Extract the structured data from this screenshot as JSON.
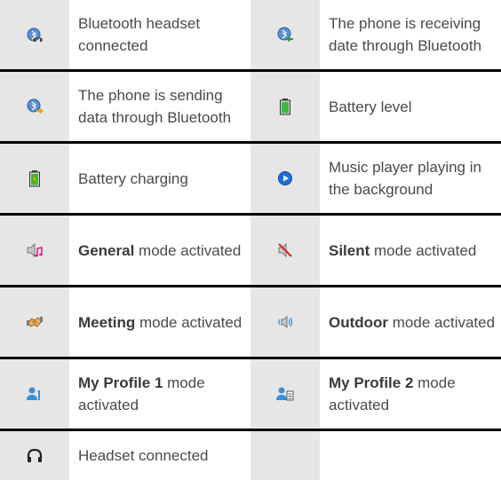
{
  "rows": [
    {
      "left": {
        "icon": "bluetooth-headset-icon",
        "bold": "",
        "text": "Bluetooth headset connected"
      },
      "right": {
        "icon": "bluetooth-receive-icon",
        "bold": "",
        "text": "The phone is receiving date through Bluetooth"
      }
    },
    {
      "left": {
        "icon": "bluetooth-send-icon",
        "bold": "",
        "text": "The phone is sending data through Bluetooth"
      },
      "right": {
        "icon": "battery-level-icon",
        "bold": "",
        "text": "Battery level"
      }
    },
    {
      "left": {
        "icon": "battery-charging-icon",
        "bold": "",
        "text": "Battery charging"
      },
      "right": {
        "icon": "music-player-icon",
        "bold": "",
        "text": "Music player playing in the background"
      }
    },
    {
      "left": {
        "icon": "general-mode-icon",
        "bold": "General",
        "text": " mode activated"
      },
      "right": {
        "icon": "silent-mode-icon",
        "bold": "Silent",
        "text": " mode activated"
      }
    },
    {
      "left": {
        "icon": "meeting-mode-icon",
        "bold": "Meeting",
        "text": " mode activated"
      },
      "right": {
        "icon": "outdoor-mode-icon",
        "bold": "Outdoor",
        "text": " mode activated"
      }
    },
    {
      "left": {
        "icon": "my-profile-1-icon",
        "bold": "My Profile 1",
        "text": " mode activated"
      },
      "right": {
        "icon": "my-profile-2-icon",
        "bold": "My Profile 2",
        "text": " mode activated"
      }
    },
    {
      "left": {
        "icon": "headset-icon",
        "bold": "",
        "text": "Headset connected"
      }
    }
  ]
}
